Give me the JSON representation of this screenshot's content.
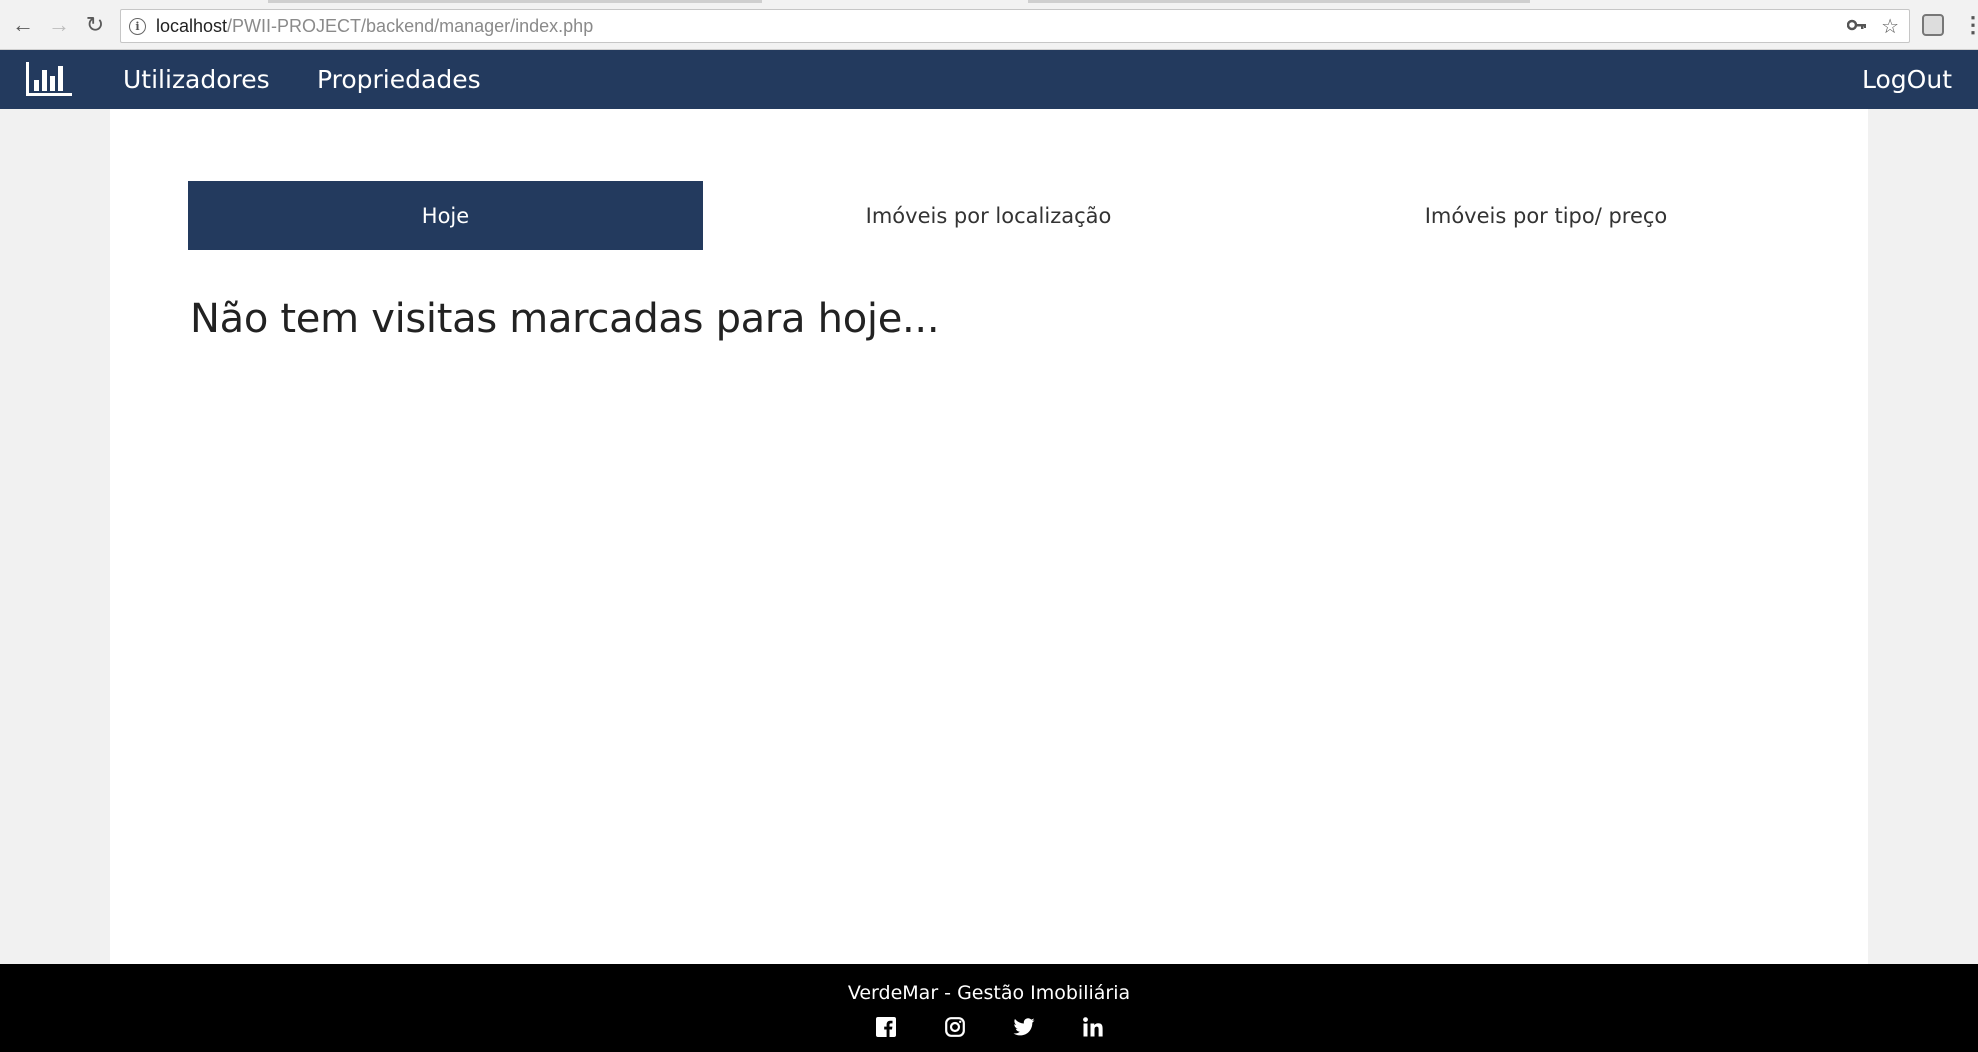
{
  "browser": {
    "url_host": "localhost",
    "url_path": "/PWII-PROJECT/backend/manager/index.php"
  },
  "navbar": {
    "logo_icon": "bar-chart-icon",
    "links": [
      "Utilizadores",
      "Propriedades"
    ],
    "logout_label": "LogOut"
  },
  "tabs": [
    {
      "label": "Hoje",
      "active": true
    },
    {
      "label": "Imóveis por localização",
      "active": false
    },
    {
      "label": "Imóveis por tipo/ preço",
      "active": false
    }
  ],
  "main": {
    "message": "Não tem visitas marcadas para hoje..."
  },
  "footer": {
    "text": "VerdeMar - Gestão Imobiliária",
    "social_icons": [
      "facebook-icon",
      "instagram-icon",
      "twitter-icon",
      "linkedin-icon"
    ]
  },
  "colors": {
    "primary": "#233a5e",
    "footer_bg": "#000000",
    "page_bg": "#f1f1f1"
  }
}
